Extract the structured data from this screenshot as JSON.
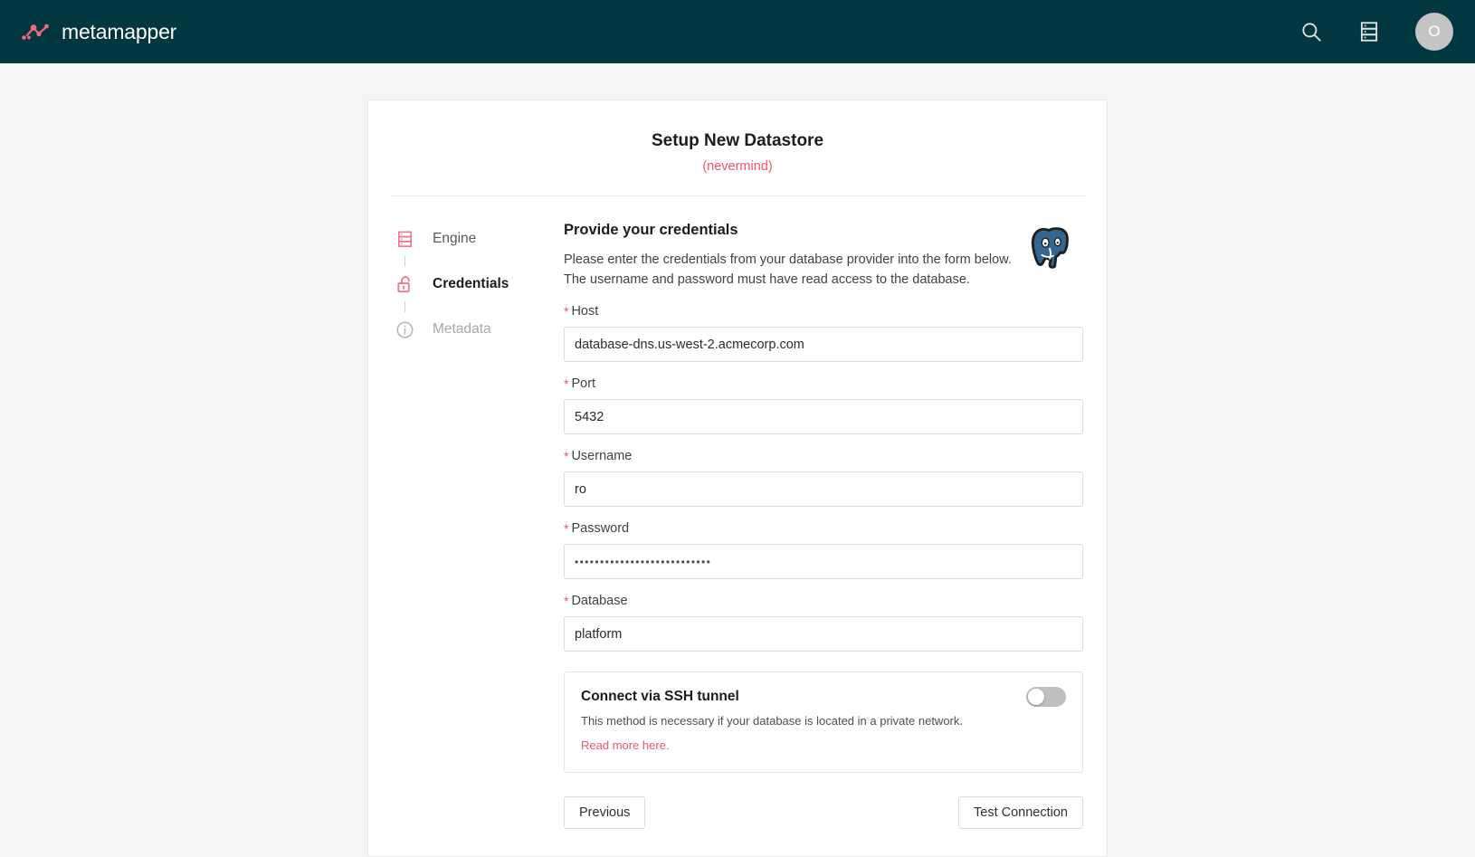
{
  "colors": {
    "topbar_bg": "#023640",
    "accent": "#f4556c",
    "page_bg": "#f4f5f7",
    "engine_logo": "#336791"
  },
  "topbar": {
    "brand_name": "metamapper",
    "brand_icon": "molecule-logo-icon",
    "search_icon": "search-icon",
    "datastores_icon": "database-stack-icon",
    "avatar_initial": "O"
  },
  "card": {
    "title": "Setup New Datastore",
    "cancel_link": "(nevermind)"
  },
  "steps": [
    {
      "label": "Engine",
      "icon": "database-stack-icon",
      "state": "complete"
    },
    {
      "label": "Credentials",
      "icon": "unlocked-padlock-icon",
      "state": "active"
    },
    {
      "label": "Metadata",
      "icon": "info-circle-icon",
      "state": "disabled"
    }
  ],
  "form": {
    "heading": "Provide your credentials",
    "description_line1": "Please enter the credentials from your database provider into the form below.",
    "description_line2": "The username and password must have read access to the database.",
    "engine_logo_name": "postgresql-elephant-icon",
    "fields": [
      {
        "label": "Host",
        "required": true,
        "value": "database-dns.us-west-2.acmecorp.com",
        "placeholder": "Host"
      },
      {
        "label": "Port",
        "required": true,
        "value": "5432",
        "placeholder": "Port"
      },
      {
        "label": "Username",
        "required": true,
        "value": "ro",
        "placeholder": "Username"
      },
      {
        "label": "Password",
        "required": true,
        "value": "•••••••••••••••••••••••••••",
        "placeholder": "Password"
      },
      {
        "label": "Database",
        "required": true,
        "value": "platform",
        "placeholder": "Database"
      }
    ]
  },
  "ssh": {
    "title": "Connect via SSH tunnel",
    "description": "This method is necessary if your database is located in a private network.",
    "link": "Read more here.",
    "enabled": false
  },
  "actions": {
    "previous_label": "Previous",
    "test_connection_label": "Test Connection"
  }
}
